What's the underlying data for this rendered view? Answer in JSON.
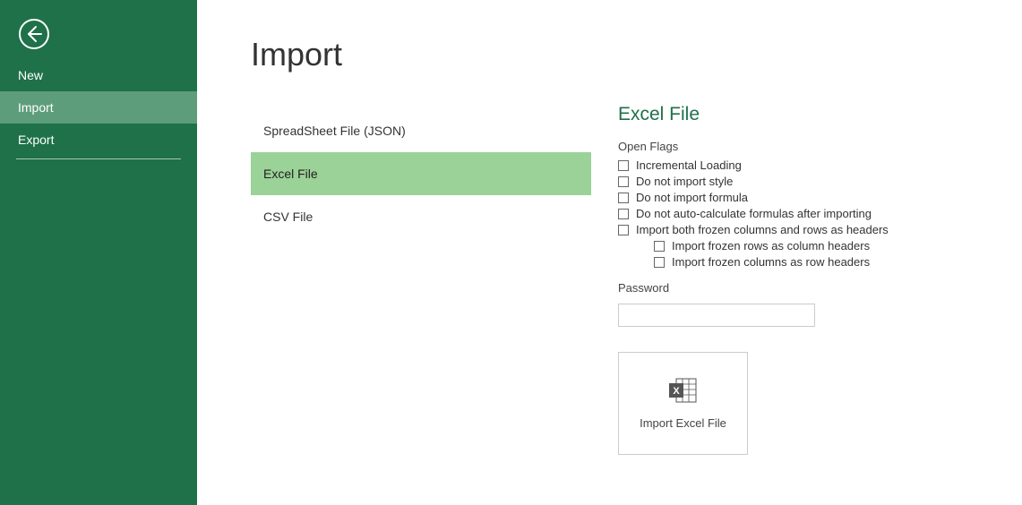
{
  "sidebar": {
    "items": [
      {
        "label": "New"
      },
      {
        "label": "Import"
      },
      {
        "label": "Export"
      }
    ],
    "activeIndex": 1
  },
  "page": {
    "title": "Import"
  },
  "importTypes": [
    {
      "label": "SpreadSheet File (JSON)"
    },
    {
      "label": "Excel File"
    },
    {
      "label": "CSV File"
    }
  ],
  "importTypesActiveIndex": 1,
  "panel": {
    "title": "Excel File",
    "openFlagsLabel": "Open Flags",
    "flags": {
      "incrementalLoading": "Incremental Loading",
      "doNotImportStyle": "Do not import style",
      "doNotImportFormula": "Do not import formula",
      "doNotAutoCalculate": "Do not auto-calculate formulas after importing",
      "importBothFrozen": "Import both frozen columns and rows as headers",
      "importFrozenRows": "Import frozen rows as column headers",
      "importFrozenCols": "Import frozen columns as row headers"
    },
    "passwordLabel": "Password",
    "passwordValue": "",
    "importButtonLabel": "Import Excel File"
  }
}
